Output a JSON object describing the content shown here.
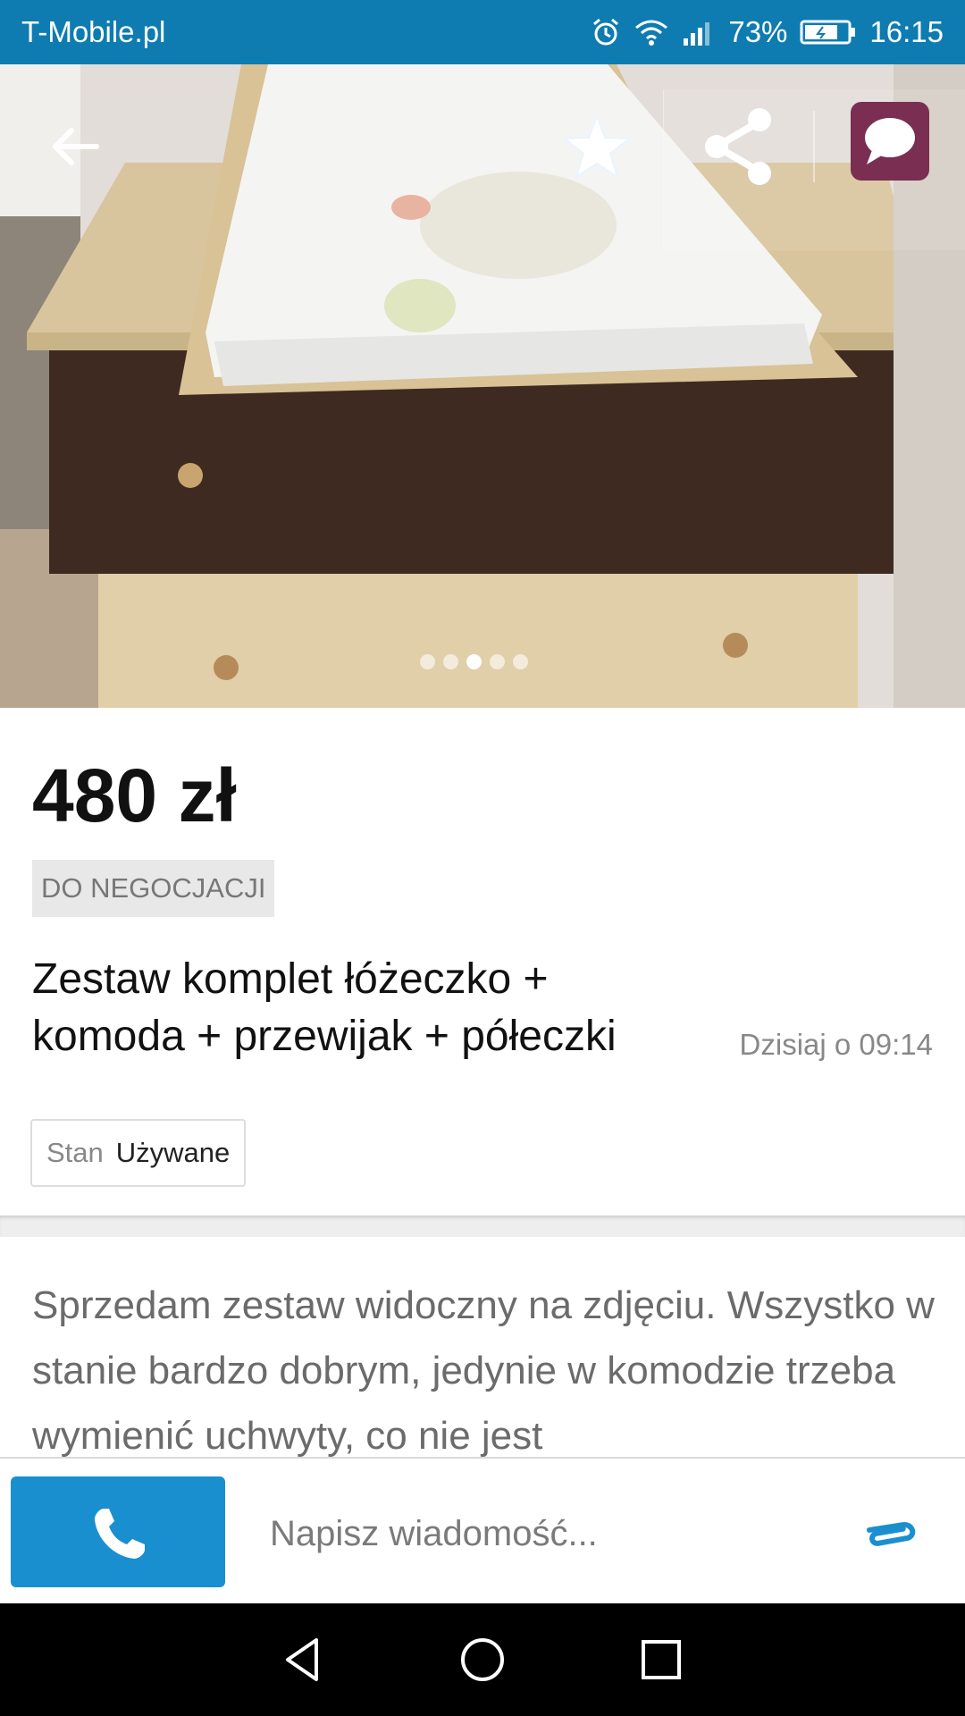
{
  "status_bar": {
    "carrier": "T-Mobile.pl",
    "battery": "73%",
    "time": "16:15",
    "icons": [
      "alarm-icon",
      "wifi-icon",
      "signal-icon",
      "battery-icon"
    ]
  },
  "hero": {
    "image_count": 5,
    "active_image_index": 2,
    "actions": [
      "back-icon",
      "star-icon",
      "share-icon",
      "chat-icon"
    ]
  },
  "listing": {
    "price": "480 zł",
    "negotiable": "DO NEGOCJACJI",
    "title": "Zestaw komplet łóżeczko + komoda + przewijak + półeczki",
    "date": "Dzisiaj o 09:14",
    "condition_label": "Stan",
    "condition_value": "Używane",
    "description": "Sprzedam zestaw widoczny na zdjęciu. Wszystko w stanie bardzo dobrym, jedynie w komodzie trzeba wymienić uchwyty, co nie jest"
  },
  "action_bar": {
    "message_placeholder": "Napisz wiadomość..."
  },
  "colors": {
    "status_bar": "#0e7cb1",
    "call_button": "#1a8fcf",
    "chat_button": "#7a2f52",
    "attach_icon": "#1a8fcf"
  }
}
